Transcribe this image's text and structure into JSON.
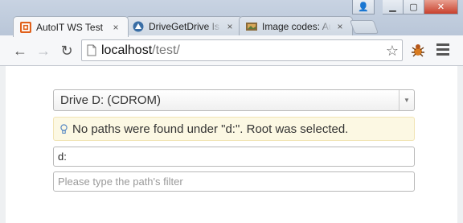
{
  "browser": {
    "tabs": [
      {
        "title": "AutoIT WS Test",
        "active": true,
        "icon": "autoit-icon"
      },
      {
        "title": "DriveGetDrive Is",
        "active": false,
        "icon": "autoit-wiki-icon"
      },
      {
        "title": "Image codes: Au",
        "active": false,
        "icon": "image-codes-icon"
      }
    ],
    "tab_close_glyph": "×",
    "window_controls": {
      "user": "👤",
      "minimize": "▁",
      "maximize": "▢",
      "close": "✕"
    },
    "address": {
      "host": "localhost",
      "path": "/test/"
    },
    "icons": {
      "back": "back-arrow-icon",
      "forward": "forward-arrow-icon",
      "reload": "reload-icon",
      "page": "page-icon",
      "star": "star-icon",
      "extension": "extension-icon",
      "menu": "hamburger-menu-icon"
    },
    "glyphs": {
      "back": "←",
      "forward": "→",
      "reload": "↻",
      "star": "☆"
    }
  },
  "page": {
    "drive_select": {
      "value": "Drive D: (CDROM)",
      "arrow": "▼"
    },
    "alert": {
      "text": "No paths were found under \"d:\". Root was selected.",
      "icon": "lightbulb-icon",
      "glyph": "💡"
    },
    "path_input": {
      "value": "d:"
    },
    "filter_input": {
      "placeholder": "Please type the path's filter"
    }
  },
  "colors": {
    "alert_background": "#fcf8e3",
    "alert_border": "#f1e4b4",
    "title_bar": "#c8d3e2"
  }
}
